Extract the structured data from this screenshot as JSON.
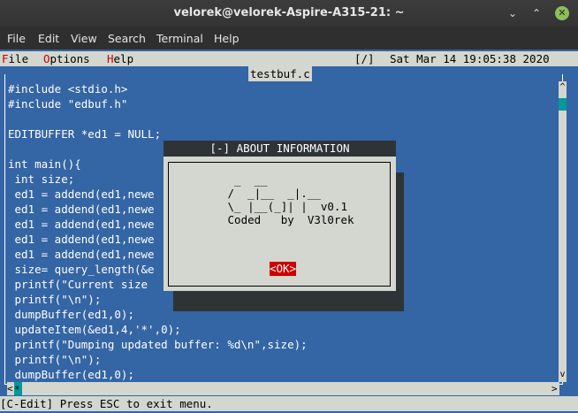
{
  "window": {
    "title": "velorek@velorek-Aspire-A315-21: ~",
    "minimize_glyph": "⌄",
    "maximize_glyph": "⌃",
    "close_glyph": "✕"
  },
  "menubar": {
    "file": "File",
    "edit": "Edit",
    "view": "View",
    "search": "Search",
    "terminal": "Terminal",
    "help": "Help"
  },
  "editor": {
    "menu": {
      "file_first": "F",
      "file_rest": "ile",
      "options_first": "O",
      "options_rest": "ptions",
      "help_first": "H",
      "help_rest": "elp"
    },
    "indicator": "[/]",
    "datetime": "Sat Mar 14 19:05:38 2020",
    "filename": "testbuf.c",
    "code_lines": [
      "#include <stdio.h>",
      "#include \"edbuf.h\"",
      "",
      "EDITBUFFER *ed1 = NULL;",
      "",
      "int main(){",
      " int size;",
      " ed1 = addend(ed1,newe",
      " ed1 = addend(ed1,newe",
      " ed1 = addend(ed1,newe",
      " ed1 = addend(ed1,newe",
      " ed1 = addend(ed1,newe",
      " size= query_length(&e",
      " printf(\"Current size",
      " printf(\"\\n\");",
      " dumpBuffer(ed1,0);",
      " updateItem(&ed1,4,'*',0);",
      " printf(\"Dumping updated buffer: %d\\n\",size);",
      " printf(\"\\n\");",
      " dumpBuffer(ed1,0);"
    ],
    "scroll": {
      "up": "^",
      "down": "v",
      "left": "<",
      "right": ">",
      "thumb": "*"
    },
    "status": "[C-Edit] Press ESC to exit menu."
  },
  "about": {
    "title": "[-] ABOUT INFORMATION",
    "art": [
      "  _  __",
      " /  _|__  _|.__",
      " \\_ |__(_]| |  v0.1",
      " Coded   by  V3l0rek"
    ],
    "ok": "<OK>"
  }
}
